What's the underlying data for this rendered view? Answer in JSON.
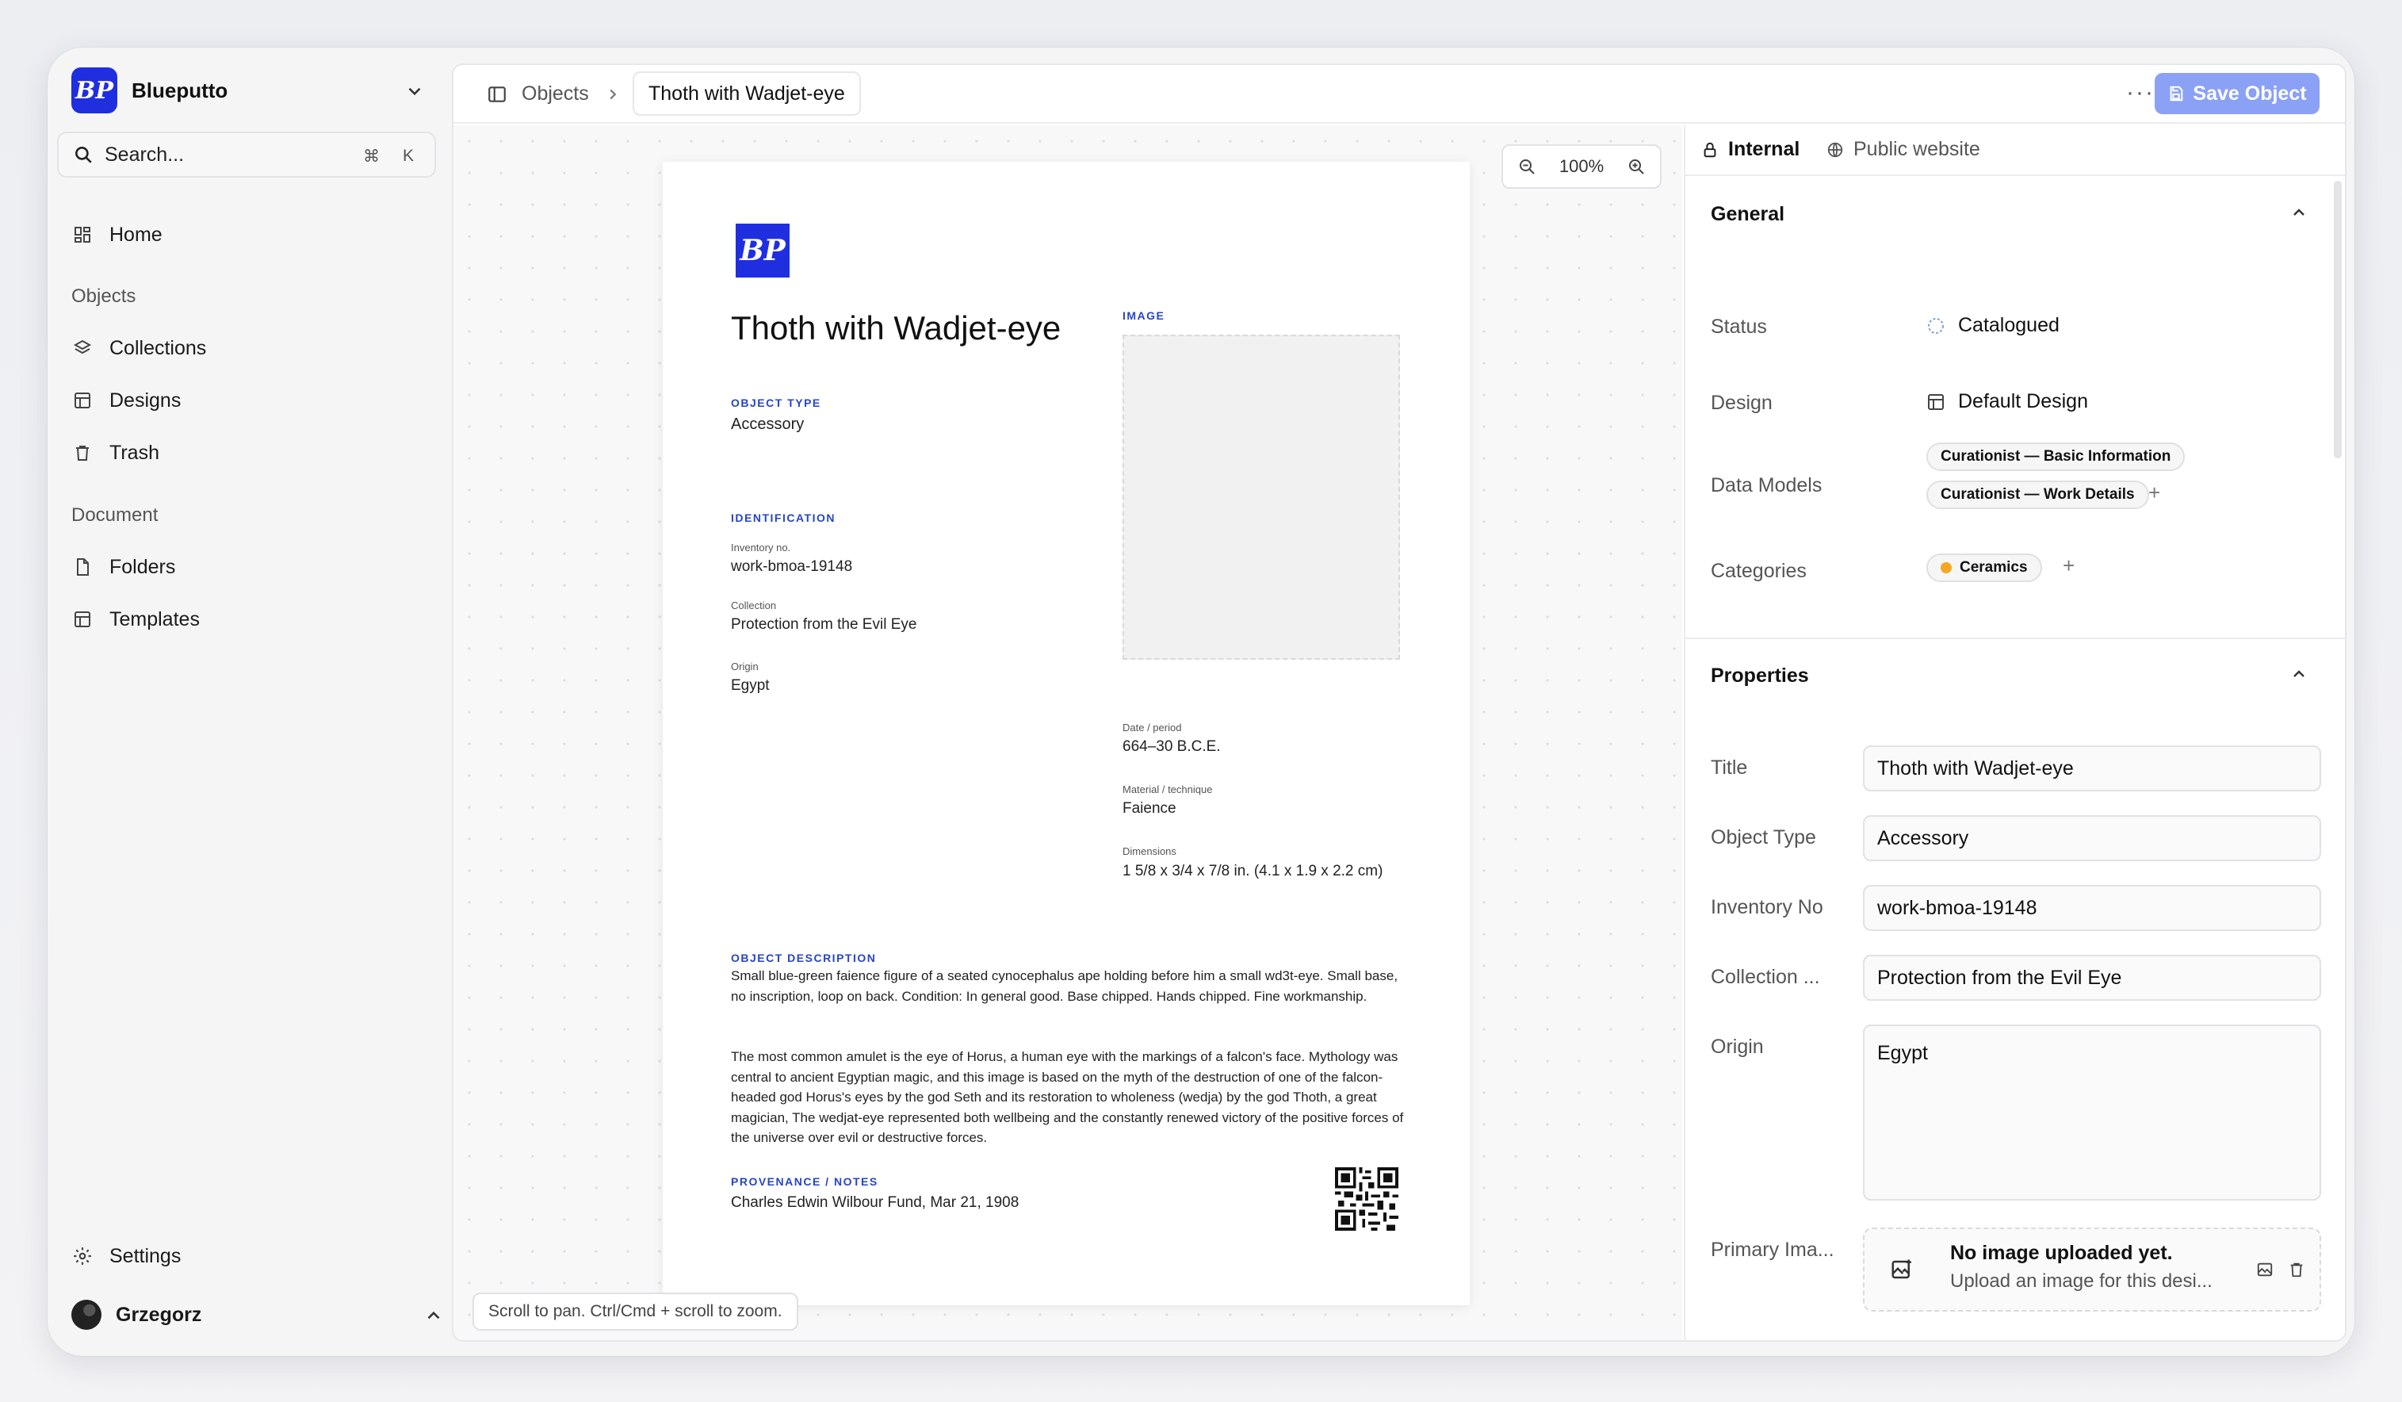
{
  "sidebar": {
    "workspace": {
      "logo_text": "BP",
      "name": "Blueputto"
    },
    "search": {
      "label": "Search...",
      "shortcut_mod": "⌘",
      "shortcut_key": "K"
    },
    "home": "Home",
    "sections": {
      "objects": "Objects",
      "document": "Document"
    },
    "items": {
      "collections": "Collections",
      "designs": "Designs",
      "trash": "Trash",
      "folders": "Folders",
      "templates": "Templates"
    },
    "settings": "Settings",
    "user": "Grzegorz"
  },
  "header": {
    "breadcrumb_root": "Objects",
    "breadcrumb_current": "Thoth with Wadjet-eye",
    "more": "···",
    "save_label": "Save Object"
  },
  "canvas": {
    "zoom": "100%",
    "hint": "Scroll to pan. Ctrl/Cmd + scroll to zoom."
  },
  "document": {
    "logo_text": "BP",
    "title": "Thoth with Wadjet-eye",
    "object_type_caption": "OBJECT TYPE",
    "object_type": "Accessory",
    "identification_caption": "IDENTIFICATION",
    "inventory_label": "Inventory no.",
    "inventory": "work-bmoa-19148",
    "collection_label": "Collection",
    "collection": "Protection from the Evil Eye",
    "origin_label": "Origin",
    "origin": "Egypt",
    "image_caption": "IMAGE",
    "date_label": "Date / period",
    "date": "664–30 B.C.E.",
    "material_label": "Material / technique",
    "material": "Faience",
    "dimensions_label": "Dimensions",
    "dimensions": "1 5/8 x 3/4 x 7/8 in. (4.1 x 1.9 x 2.2 cm)",
    "description_caption": "OBJECT DESCRIPTION",
    "description_1": "Small blue-green faience figure of a seated cynocephalus ape holding before him a small wd3t-eye. Small base, no inscription, loop on back. Condition: In general good. Base chipped. Hands chipped. Fine workmanship.",
    "description_2": "The most common amulet is the eye of Horus, a human eye with the markings of a falcon's face. Mythology was central to ancient Egyptian magic, and this image is based on the myth of the destruction of one of the falcon-headed god Horus's eyes by the god Seth and its restoration to wholeness (wedja) by the god Thoth, a great magician, The wedjat-eye represented both wellbeing and the constantly renewed victory of the positive forces of the universe over evil or destructive forces.",
    "provenance_caption": "PROVENANCE / NOTES",
    "provenance": "Charles Edwin Wilbour Fund, Mar 21, 1908"
  },
  "panel": {
    "tabs": {
      "internal": "Internal",
      "public": "Public website"
    },
    "general": {
      "heading": "General",
      "status_label": "Status",
      "status": "Catalogued",
      "design_label": "Design",
      "design": "Default Design",
      "models_label": "Data Models",
      "models": [
        "Curationist — Basic Information",
        "Curationist — Work Details"
      ],
      "categories_label": "Categories",
      "category": "Ceramics",
      "category_color": "#f5a623"
    },
    "properties": {
      "heading": "Properties",
      "title_label": "Title",
      "title": "Thoth with Wadjet-eye",
      "type_label": "Object Type",
      "type": "Accessory",
      "inventory_label": "Inventory No",
      "inventory": "work-bmoa-19148",
      "collection_label": "Collection ...",
      "collection": "Protection from the Evil Eye",
      "origin_label": "Origin",
      "origin": "Egypt",
      "primary_image_label": "Primary Ima...",
      "upload_title": "No image uploaded yet.",
      "upload_sub": "Upload an image for this desi..."
    }
  },
  "colors": {
    "brand": "#1f2fe0",
    "accent_button": "#8aa1f5",
    "caption_blue": "#2645c7"
  }
}
